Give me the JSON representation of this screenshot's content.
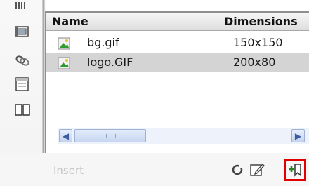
{
  "assets_panel": {
    "columns": {
      "name": "Name",
      "dimensions": "Dimensions"
    },
    "rows": [
      {
        "name": "bg.gif",
        "dimensions": "150x150",
        "icon": "gif-image-icon",
        "selected": false
      },
      {
        "name": "logo.GIF",
        "dimensions": "200x80",
        "icon": "gif-image-icon",
        "selected": true
      }
    ]
  },
  "sidebar": {
    "icons": [
      "images-category-icon",
      "movie-category-icon",
      "links-category-icon",
      "templates-category-icon",
      "library-category-icon"
    ]
  },
  "toolbar": {
    "insert_label": "Insert",
    "buttons": [
      "refresh-icon",
      "edit-icon",
      "new-favorite-icon"
    ],
    "highlight_color": "#e00000"
  }
}
